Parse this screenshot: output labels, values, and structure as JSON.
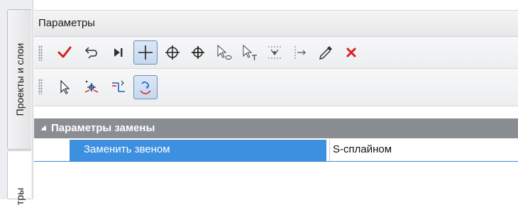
{
  "side_tabs": [
    {
      "label": "Проекты и слои"
    },
    {
      "label": "тры"
    }
  ],
  "panel": {
    "title": "Параметры"
  },
  "toolbar1": {
    "buttons": [
      {
        "icon": "checkmark-icon",
        "color": "#d82020"
      },
      {
        "icon": "undo-arrow-icon"
      },
      {
        "icon": "skip-to-end-icon"
      },
      {
        "icon": "crosshair-plus-icon",
        "active": true
      },
      {
        "icon": "circle-crosshair-icon"
      },
      {
        "icon": "circle-crosshair-alt-icon"
      },
      {
        "icon": "cursor-circle-icon"
      },
      {
        "icon": "cursor-t-icon"
      },
      {
        "icon": "dashed-snap-icon"
      },
      {
        "icon": "dashed-node-icon"
      },
      {
        "icon": "eyedropper-icon"
      },
      {
        "icon": "close-icon",
        "color": "#d82020"
      }
    ]
  },
  "toolbar2": {
    "buttons": [
      {
        "icon": "cursor-icon"
      },
      {
        "icon": "node-add-icon"
      },
      {
        "icon": "segment-edit-icon"
      },
      {
        "icon": "replace-spline-icon",
        "active": true
      }
    ]
  },
  "property_grid": {
    "section_label": "Параметры замены",
    "rows": [
      {
        "name": "Заменить звеном",
        "value": "S-сплайном"
      }
    ]
  },
  "colors": {
    "header_bg": "#8a8d92",
    "selection_bg": "#3d8fe0",
    "accent_red": "#d82020",
    "accent_blue": "#1e5ec8"
  }
}
